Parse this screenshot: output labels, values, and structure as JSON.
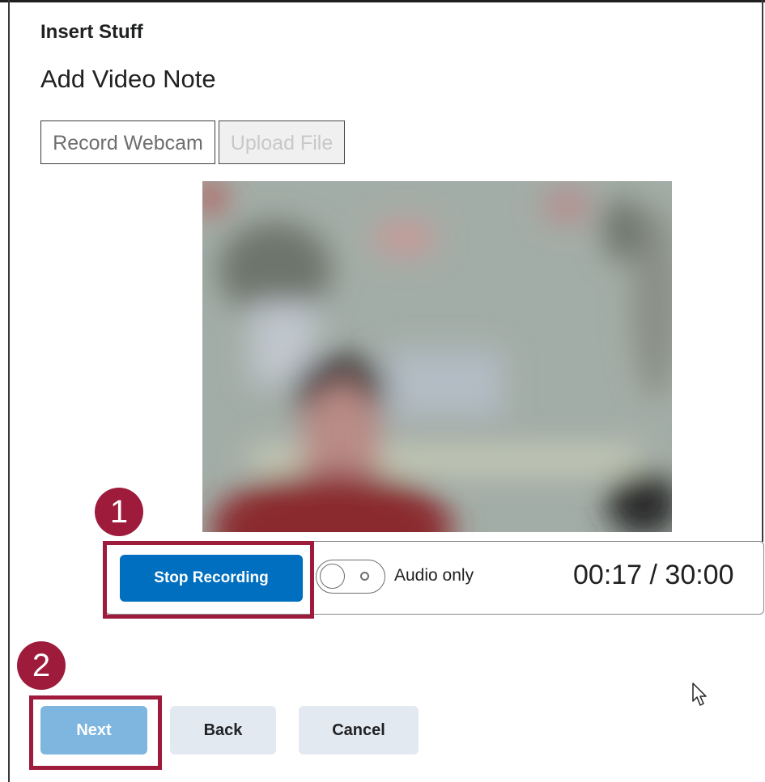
{
  "dialog": {
    "title": "Insert Stuff",
    "heading": "Add Video Note"
  },
  "tabs": [
    {
      "label": "Record Webcam",
      "state": "selected"
    },
    {
      "label": "Upload File",
      "state": "disabled"
    }
  ],
  "recorder": {
    "stop_label": "Stop Recording",
    "audio_only_label": "Audio only",
    "audio_only_checked": false,
    "timer": "00:17 / 30:00"
  },
  "annotations": {
    "step1": "1",
    "step2": "2"
  },
  "actions": {
    "next_label": "Next",
    "back_label": "Back",
    "cancel_label": "Cancel"
  },
  "colors": {
    "primary": "#006fbf",
    "primary_disabled": "#7fb6e0",
    "secondary": "#e3e9f1",
    "annotation": "#9e1b3c"
  }
}
